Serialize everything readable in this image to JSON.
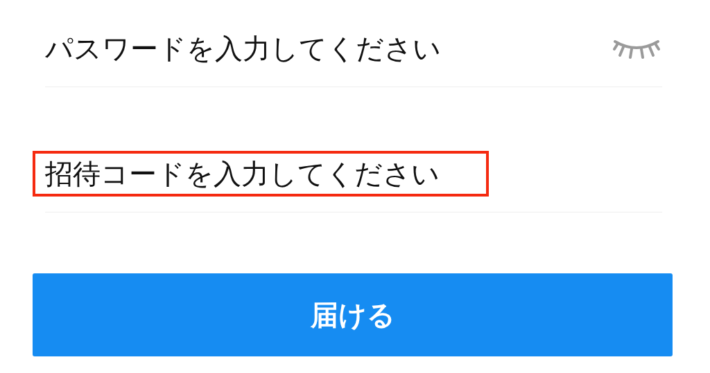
{
  "fields": [
    {
      "kind": "password",
      "placeholder": "パスワードを入力してください",
      "password_visible": false,
      "highlighted": false
    },
    {
      "kind": "text",
      "placeholder": "招待コードを入力してください",
      "highlighted": true
    }
  ],
  "submit_button": {
    "label": "届ける"
  }
}
